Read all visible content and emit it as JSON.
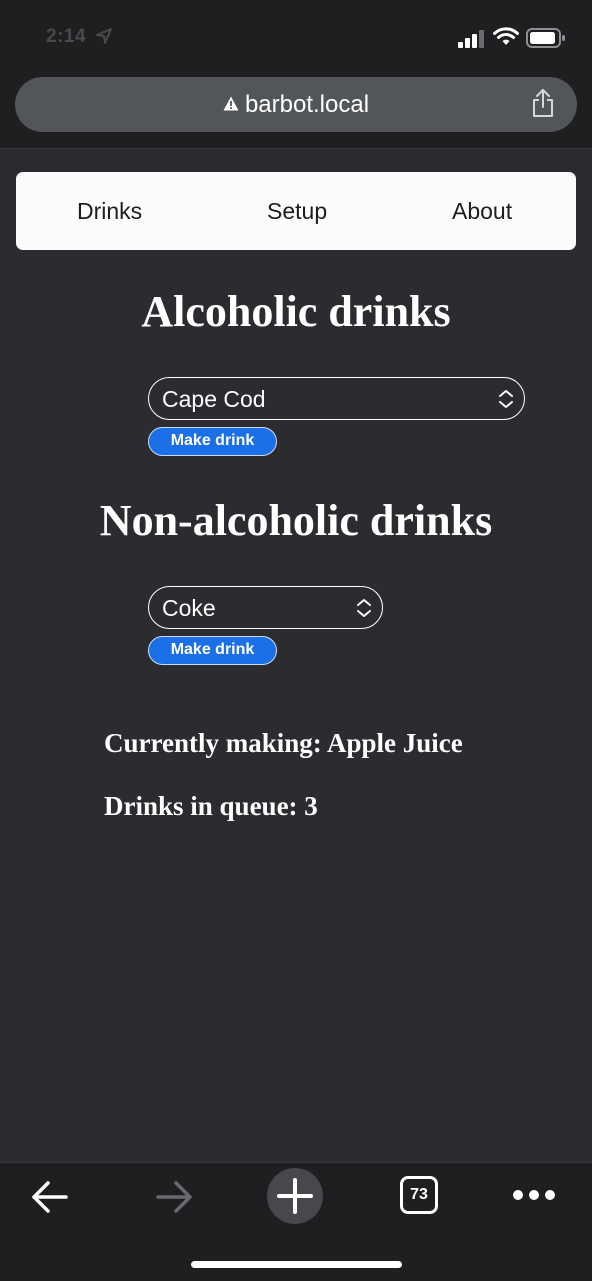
{
  "status_bar": {
    "time": "2:14"
  },
  "browser": {
    "url": "barbot.local",
    "tab_count": "73"
  },
  "nav": {
    "items": [
      "Drinks",
      "Setup",
      "About"
    ]
  },
  "alcoholic": {
    "heading": "Alcoholic drinks",
    "selected": "Cape Cod",
    "button_label": "Make drink"
  },
  "non_alcoholic": {
    "heading": "Non-alcoholic drinks",
    "selected": "Coke",
    "button_label": "Make drink"
  },
  "status": {
    "currently_making": "Currently making: Apple Juice",
    "queue": "Drinks in queue: 3"
  },
  "colors": {
    "background": "#2c2b2f",
    "button": "#1b70e8",
    "nav_background": "#fcfbfd"
  }
}
